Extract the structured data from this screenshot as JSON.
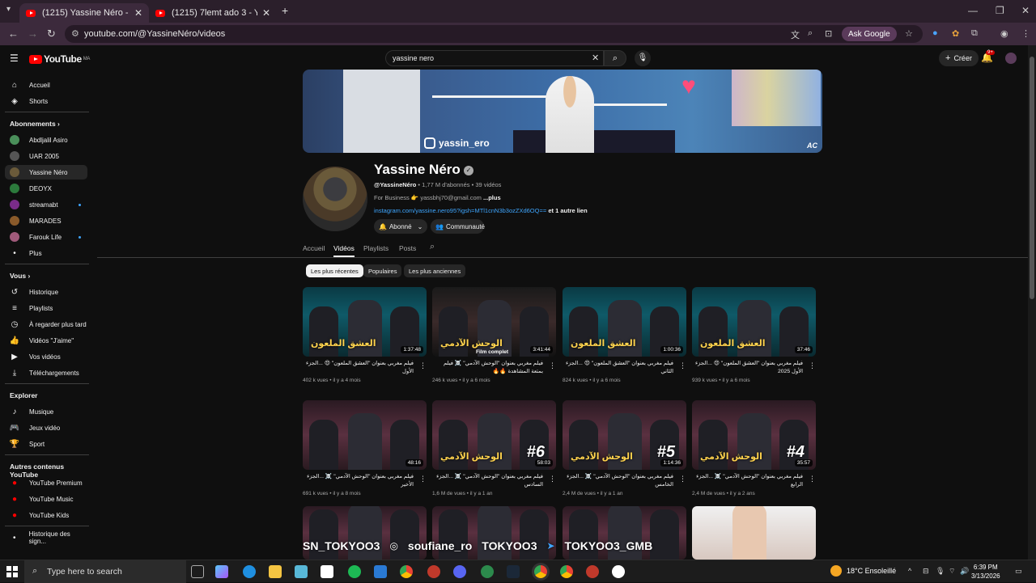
{
  "browser": {
    "tabs": [
      {
        "title": "(1215) Yassine Néro - YouTube",
        "active": true
      },
      {
        "title": "(1215) 7lemt ado 3 - YouTube",
        "active": false
      }
    ],
    "url": "youtube.com/@YassineNéro/videos",
    "ask_google": "Ask Google"
  },
  "header": {
    "logo": "YouTube",
    "logo_region": "MA",
    "search_value": "yassine nero",
    "create_label": "Créer",
    "notif_count": "9+"
  },
  "sidebar": {
    "main": [
      {
        "label": "Accueil",
        "icon": "home-icon"
      },
      {
        "label": "Shorts",
        "icon": "shorts-icon"
      }
    ],
    "subscriptions_title": "Abonnements",
    "subscriptions": [
      {
        "label": "Abdljalil Asiro",
        "color": "#4a8f5a",
        "dot": false
      },
      {
        "label": "UAR 2005",
        "color": "#555555",
        "dot": false
      },
      {
        "label": "Yassine Néro",
        "color": "#6a5a3a",
        "dot": false,
        "selected": true
      },
      {
        "label": "DEOYX",
        "color": "#2c7a3c",
        "dot": false
      },
      {
        "label": "streamabt",
        "color": "#7a2c8a",
        "dot": true
      },
      {
        "label": "MARADES",
        "color": "#8a5a2a",
        "dot": false
      },
      {
        "label": "Farouk Life",
        "color": "#a05a7a",
        "dot": true
      },
      {
        "label": "Plus",
        "color": "",
        "dot": false
      }
    ],
    "you_title": "Vous",
    "you": [
      {
        "label": "Historique",
        "icon": "history-icon"
      },
      {
        "label": "Playlists",
        "icon": "playlists-icon"
      },
      {
        "label": "À regarder plus tard",
        "icon": "watch-later-icon"
      },
      {
        "label": "Vidéos \"J'aime\"",
        "icon": "like-icon"
      },
      {
        "label": "Vos vidéos",
        "icon": "your-videos-icon"
      },
      {
        "label": "Téléchargements",
        "icon": "download-icon"
      }
    ],
    "explore_title": "Explorer",
    "explore": [
      {
        "label": "Musique",
        "icon": "music-icon"
      },
      {
        "label": "Jeux vidéo",
        "icon": "gaming-icon"
      },
      {
        "label": "Sport",
        "icon": "trophy-icon"
      }
    ],
    "more_title": "Autres contenus YouTube",
    "more": [
      {
        "label": "YouTube Premium",
        "icon": "yt-premium-icon"
      },
      {
        "label": "YouTube Music",
        "icon": "yt-music-icon"
      },
      {
        "label": "YouTube Kids",
        "icon": "yt-kids-icon"
      }
    ],
    "report": "Historique des sign..."
  },
  "channel": {
    "banner_handle": "yassin_ero",
    "banner_mark": "AC",
    "name": "Yassine Néro",
    "handle": "@YassineNéro",
    "stats": " • 1,77 M d'abonnés • 39 vidéos",
    "business_prefix": "For Business",
    "business_email": "yassbhj70@gmail.com",
    "business_more": "...plus",
    "link": "instagram.com/yassine.nero95?igsh=MTl1cnN3b3ozZXd6OQ==",
    "link_extra": " et 1 autre lien",
    "subscribe_label": "Abonné",
    "community_label": "Communauté",
    "tabs": [
      "Accueil",
      "Vidéos",
      "Playlists",
      "Posts"
    ],
    "chips": [
      "Les plus récentes",
      "Populaires",
      "Les plus anciennes"
    ]
  },
  "videos": [
    {
      "title": "فيلم مغربي بعنوان \"العشق الملعون\" 😍 ...الجزء الأول",
      "meta": "402 k vues • il y a 4 mois",
      "duration": "1:37:48",
      "overlay": "العشق الملعون",
      "num": "",
      "bg": "bg-cyan"
    },
    {
      "title": "فيلم مغربي بعنوان \"الوحش الآدمي\" ☠️ فيلم بمتعة المشاهدة 🔥🔥",
      "meta": "246 k vues • il y a 6 mois",
      "duration": "3:41:44",
      "overlay": "الوحش الآدمي",
      "num": "",
      "bg": "bg-dark",
      "sub": "Film complet"
    },
    {
      "title": "فيلم مغربي بعنوان \"العشق الملعون\" 😍 ...الجزء الثاني",
      "meta": "824 k vues • il y a 6 mois",
      "duration": "1:00:36",
      "overlay": "العشق الملعون",
      "num": "",
      "bg": "bg-cyan"
    },
    {
      "title": "فيلم مغربي بعنوان \"العشق الملعون\" 😍 ...الجزء الأول 2025",
      "meta": "939 k vues • il y a 6 mois",
      "duration": "37:46",
      "overlay": "العشق الملعون",
      "num": "",
      "bg": "bg-cyan"
    },
    {
      "title": "فيلم مغربي بعنوان \"الوحش الآدمي\" ☠️ ...الجزء الأخير",
      "meta": "691 k vues • il y a 8 mois",
      "duration": "48:16",
      "overlay": "",
      "num": "",
      "bg": "bg-maroon"
    },
    {
      "title": "فيلم مغربي بعنوان \"الوحش الآدمي\" ☠️ ...الجزء السادس",
      "meta": "1,6 M de vues • il y a 1 an",
      "duration": "58:03",
      "overlay": "الوحش الآدمي",
      "num": "#6",
      "bg": "bg-maroon"
    },
    {
      "title": "فيلم مغربي بعنوان \"الوحش الآدمي\" ☠️ ...الجزء الخامس",
      "meta": "2,4 M de vues • il y a 1 an",
      "duration": "1:14:36",
      "overlay": "الوحش الآدمي",
      "num": "#5",
      "bg": "bg-maroon"
    },
    {
      "title": "فيلم مغربي بعنوان \"الوحش الآدمي\" ☠️ ...الجزء الرابع",
      "meta": "2,4 M de vues • il y a 2 ans",
      "duration": "35:57",
      "overlay": "الوحش الآدمي",
      "num": "#4",
      "bg": "bg-maroon"
    }
  ],
  "row3_overlay": [
    "SN_TOKYOO3",
    "soufiane_ro",
    "TOKYOO3",
    "TOKYOO3_GMB"
  ],
  "taskbar": {
    "search_placeholder": "Type here to search",
    "weather": "18°C  Ensoleillé",
    "time": "6:39 PM",
    "date": "3/13/2026"
  }
}
